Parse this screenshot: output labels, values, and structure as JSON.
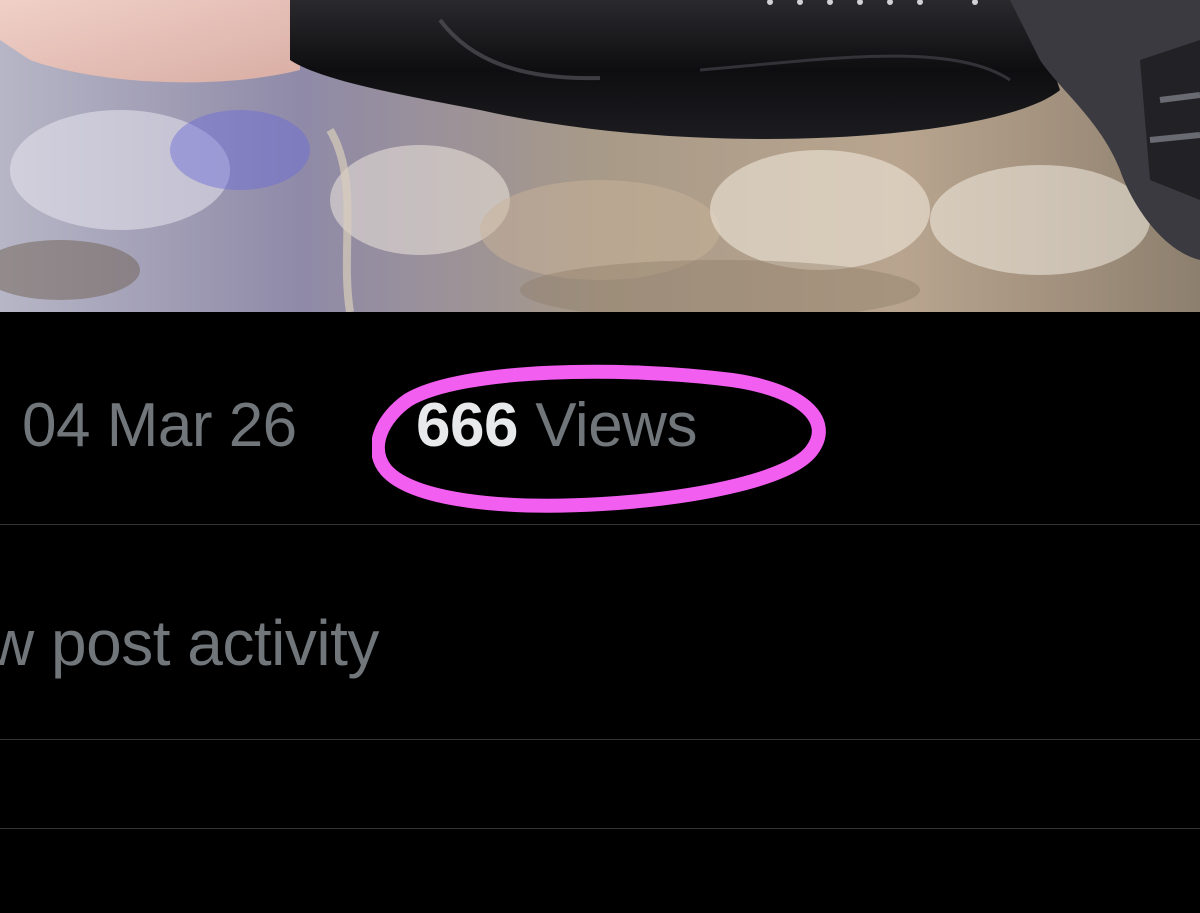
{
  "post": {
    "image": {
      "description_icon": "photo-icon"
    },
    "date": "04 Mar 26",
    "views_count": "666",
    "views_label": "Views",
    "highlight_color": "#f25ef0"
  },
  "actions": {
    "view_activity_label": "w post activity",
    "next_row_label": "..."
  },
  "colors": {
    "background": "#000000",
    "primary_text": "#e7e9ea",
    "secondary_text": "#71767b",
    "divider": "#2f3336"
  }
}
